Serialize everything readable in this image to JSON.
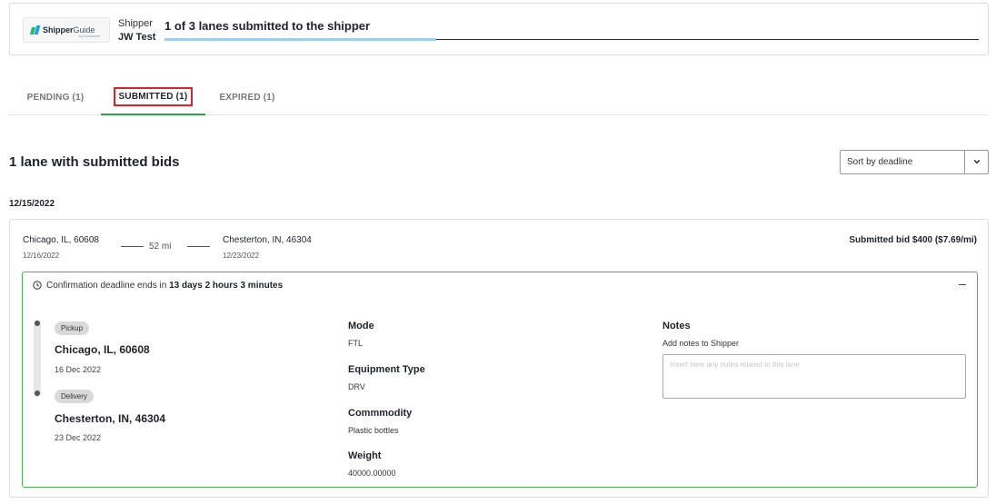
{
  "header": {
    "logo_text_bold": "Shipper",
    "logo_text_light": "Guide",
    "logo_sub": "by loadsmart",
    "shipper_label": "Shipper",
    "company": "JW Test",
    "progress_text": "1 of 3 lanes submitted to the shipper",
    "progress_fraction": 0.3333
  },
  "tabs": [
    {
      "label": "PENDING (1)",
      "active": false
    },
    {
      "label": "SUBMITTED (1)",
      "active": true
    },
    {
      "label": "EXPIRED (1)",
      "active": false
    }
  ],
  "main": {
    "lane_count": "1 lane with submitted bids",
    "sort_value": "Sort by deadline",
    "date_heading": "12/15/2022"
  },
  "lane": {
    "origin_city": "Chicago, IL, 60608",
    "origin_date": "12/16/2022",
    "distance": "52 mi",
    "destination_city": "Chesterton, IN, 46304",
    "destination_date": "12/23/2022",
    "bid": "Submitted bid $400 ($7.69/mi)",
    "deadline_prefix": "Confirmation deadline ends in ",
    "deadline_value": "13 days 2 hours 3 minutes",
    "pickup_label": "Pickup",
    "pickup_city": "Chicago, IL, 60608",
    "pickup_date": "16 Dec 2022",
    "delivery_label": "Delivery",
    "delivery_city": "Chesterton, IN, 46304",
    "delivery_date": "23 Dec 2022",
    "mode_label": "Mode",
    "mode_value": "FTL",
    "equipment_label": "Equipment Type",
    "equipment_value": "DRV",
    "commodity_label": "Commmodity",
    "commodity_value": "Plastic bottles",
    "weight_label": "Weight",
    "weight_value": "40000.00000",
    "notes_label": "Notes",
    "notes_sub": "Add notes to Shipper",
    "notes_placeholder": "Insert here any notes related to this lane",
    "notes_value": ""
  },
  "colors": {
    "accent_green": "#28a745",
    "progress_blue": "#9fd0ee",
    "highlight_red": "#d9222a"
  }
}
